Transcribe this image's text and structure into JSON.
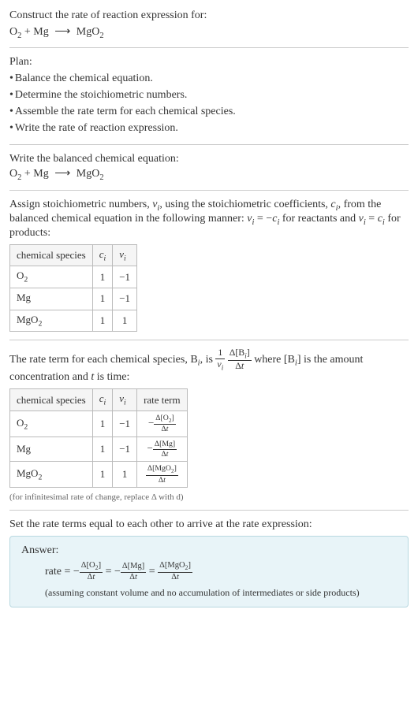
{
  "prompt": {
    "text": "Construct the rate of reaction expression for:",
    "equation_o2": "O",
    "equation_o2_sub": "2",
    "equation_plus": " + Mg ",
    "equation_arrow": "⟶",
    "equation_mgo2": " MgO",
    "equation_mgo2_sub": "2"
  },
  "plan": {
    "label": "Plan:",
    "items": [
      "Balance the chemical equation.",
      "Determine the stoichiometric numbers.",
      "Assemble the rate term for each chemical species.",
      "Write the rate of reaction expression."
    ]
  },
  "balanced": {
    "text": "Write the balanced chemical equation:"
  },
  "stoich": {
    "text_part1": "Assign stoichiometric numbers, ",
    "nu_i": "ν",
    "nu_i_sub": "i",
    "text_part2": ", using the stoichiometric coefficients, ",
    "c_i": "c",
    "c_i_sub": "i",
    "text_part3": ", from the balanced chemical equation in the following manner: ",
    "eq1_lhs": "ν",
    "eq1_lhs_sub": "i",
    "eq1_mid": " = −",
    "eq1_rhs": "c",
    "eq1_rhs_sub": "i",
    "text_part4": " for reactants and ",
    "eq2_lhs": "ν",
    "eq2_lhs_sub": "i",
    "eq2_mid": " = ",
    "eq2_rhs": "c",
    "eq2_rhs_sub": "i",
    "text_part5": " for products:",
    "table": {
      "headers": {
        "species": "chemical species",
        "ci": "c",
        "ci_sub": "i",
        "nui": "ν",
        "nui_sub": "i"
      },
      "rows": [
        {
          "species_a": "O",
          "species_sub": "2",
          "ci": "1",
          "nui": "−1"
        },
        {
          "species_a": "Mg",
          "species_sub": "",
          "ci": "1",
          "nui": "−1"
        },
        {
          "species_a": "MgO",
          "species_sub": "2",
          "ci": "1",
          "nui": "1"
        }
      ]
    }
  },
  "rateterm": {
    "text_part1": "The rate term for each chemical species, B",
    "bi_sub": "i",
    "text_part2": ", is ",
    "frac1_num": "1",
    "frac1_den_a": "ν",
    "frac1_den_sub": "i",
    "frac2_num_a": "Δ[B",
    "frac2_num_sub": "i",
    "frac2_num_b": "]",
    "frac2_den": "Δt",
    "text_part3": " where [B",
    "text_part3_sub": "i",
    "text_part4": "] is the amount concentration and ",
    "t_var": "t",
    "text_part5": " is time:",
    "table": {
      "headers": {
        "species": "chemical species",
        "ci": "c",
        "ci_sub": "i",
        "nui": "ν",
        "nui_sub": "i",
        "rateterm": "rate term"
      },
      "rows": [
        {
          "species_a": "O",
          "species_sub": "2",
          "ci": "1",
          "nui": "−1",
          "rate_neg": "−",
          "rate_num": "Δ[O",
          "rate_num_sub": "2",
          "rate_num_b": "]",
          "rate_den": "Δt"
        },
        {
          "species_a": "Mg",
          "species_sub": "",
          "ci": "1",
          "nui": "−1",
          "rate_neg": "−",
          "rate_num": "Δ[Mg]",
          "rate_num_sub": "",
          "rate_num_b": "",
          "rate_den": "Δt"
        },
        {
          "species_a": "MgO",
          "species_sub": "2",
          "ci": "1",
          "nui": "1",
          "rate_neg": "",
          "rate_num": "Δ[MgO",
          "rate_num_sub": "2",
          "rate_num_b": "]",
          "rate_den": "Δt"
        }
      ]
    },
    "footnote": "(for infinitesimal rate of change, replace Δ with d)"
  },
  "final": {
    "text": "Set the rate terms equal to each other to arrive at the rate expression:"
  },
  "answer": {
    "label": "Answer:",
    "rate_label": "rate = ",
    "neg": "−",
    "t1_num": "Δ[O",
    "t1_num_sub": "2",
    "t1_num_b": "]",
    "t1_den": "Δt",
    "eq": " = ",
    "t2_num": "Δ[Mg]",
    "t2_den": "Δt",
    "t3_num": "Δ[MgO",
    "t3_num_sub": "2",
    "t3_num_b": "]",
    "t3_den": "Δt",
    "note": "(assuming constant volume and no accumulation of intermediates or side products)"
  }
}
